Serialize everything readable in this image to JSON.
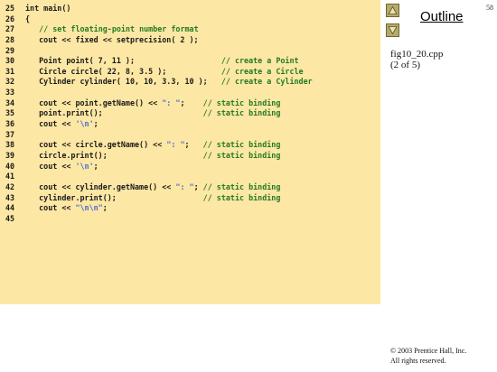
{
  "slide": {
    "page_number": "58",
    "outline_title": "Outline",
    "file_name": "fig10_20.cpp",
    "page_of": "(2 of 5)",
    "copyright_line1": "© 2003 Prentice Hall, Inc.",
    "copyright_line2": "All rights reserved."
  },
  "nav": {
    "up_icon": "triangle-up-icon",
    "down_icon": "triangle-down-icon"
  },
  "colors": {
    "panel_background": "#fde7a4",
    "code_text": "#1a1a1a",
    "comment": "#247a24",
    "string_literal": "#4a6ad0"
  },
  "code": {
    "lines": [
      {
        "num": "25",
        "code": "int main()",
        "comment": ""
      },
      {
        "num": "26",
        "code": "{",
        "comment": ""
      },
      {
        "num": "27",
        "code": "   ",
        "comment": "// set floating-point number format"
      },
      {
        "num": "28",
        "code": "   cout << fixed << setprecision( 2 );",
        "comment": ""
      },
      {
        "num": "29",
        "code": "",
        "comment": ""
      },
      {
        "num": "30",
        "code": "   Point point( 7, 11 );                   ",
        "comment": "// create a Point"
      },
      {
        "num": "31",
        "code": "   Circle circle( 22, 8, 3.5 );            ",
        "comment": "// create a Circle"
      },
      {
        "num": "32",
        "code": "   Cylinder cylinder( 10, 10, 3.3, 10 );   ",
        "comment": "// create a Cylinder"
      },
      {
        "num": "33",
        "code": "",
        "comment": ""
      },
      {
        "num": "34",
        "code": "   cout << point.getName() << \": \";    ",
        "comment": "// static binding"
      },
      {
        "num": "35",
        "code": "   point.print();                      ",
        "comment": "// static binding"
      },
      {
        "num": "36",
        "code": "   cout << '\\n';",
        "comment": ""
      },
      {
        "num": "37",
        "code": "",
        "comment": ""
      },
      {
        "num": "38",
        "code": "   cout << circle.getName() << \": \";   ",
        "comment": "// static binding"
      },
      {
        "num": "39",
        "code": "   circle.print();                     ",
        "comment": "// static binding"
      },
      {
        "num": "40",
        "code": "   cout << '\\n';",
        "comment": ""
      },
      {
        "num": "41",
        "code": "",
        "comment": ""
      },
      {
        "num": "42",
        "code": "   cout << cylinder.getName() << \": \"; ",
        "comment": "// static binding"
      },
      {
        "num": "43",
        "code": "   cylinder.print();                   ",
        "comment": "// static binding"
      },
      {
        "num": "44",
        "code": "   cout << \"\\n\\n\";",
        "comment": ""
      },
      {
        "num": "45",
        "code": "",
        "comment": ""
      }
    ]
  }
}
